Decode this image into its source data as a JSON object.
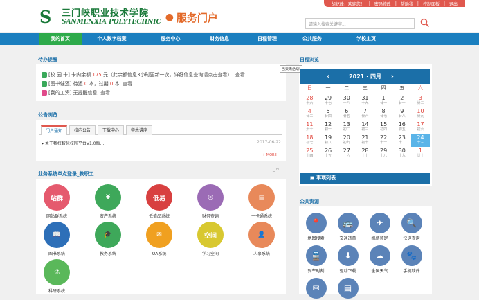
{
  "topbar": {
    "welcome": "胡屹峰，欢迎您！",
    "change_pwd": "密码修改",
    "help": "帮助我",
    "control": "控制面板",
    "logout": "退出"
  },
  "header": {
    "logo_cn": "三门峡职业技术学院",
    "logo_en": "SANMENXIA POLYTECHNIC",
    "portal": "服务门户",
    "search_placeholder": "请输入搜索关键字..."
  },
  "nav": [
    {
      "label": "我的首页",
      "active": true
    },
    {
      "label": "个人数字档案"
    },
    {
      "label": "服务中心"
    },
    {
      "label": "财务信息"
    },
    {
      "label": "日程管理"
    },
    {
      "label": "公共服务"
    },
    {
      "label": "学校主页"
    }
  ],
  "todo": {
    "title": "待办提醒",
    "rows": [
      {
        "prefix": "[校 园 卡] 卡内余额",
        "amount": "175",
        "suffix": "元（此余额信息3小时更新一次，详细信息查询请点击查看）",
        "link": "查看",
        "color": "#3aa85a"
      },
      {
        "prefix": "[图书催还] 待还",
        "amount": "0",
        "mid": "本，过期",
        "amount2": "0",
        "suffix": "本",
        "link": "查看",
        "color": "#3aa85a"
      },
      {
        "prefix": "[我的工资] 无提醒信息",
        "link": "查看",
        "color": "#e04a8a"
      }
    ]
  },
  "announce": {
    "title": "公告浏览",
    "tabs": [
      "门户通知",
      "校内公告",
      "下载中心",
      "学术讲座"
    ],
    "items": [
      {
        "text": "关于我校智慧校园平台V1.0版...",
        "date": "2017-06-22"
      }
    ],
    "more": "MORE"
  },
  "apps": {
    "title": "业务系统单点登录_教职工",
    "items": [
      {
        "label": "网站群系统",
        "color": "#e55a6e",
        "glyph": "站群"
      },
      {
        "label": "资产系统",
        "color": "#3ea85a",
        "glyph": "¥"
      },
      {
        "label": "低值品系统",
        "color": "#d84040",
        "glyph": "低易"
      },
      {
        "label": "财务查询",
        "color": "#9b6bb5",
        "glyph": "◎"
      },
      {
        "label": "一卡通系统",
        "color": "#e8895a",
        "glyph": "▤"
      },
      {
        "label": "图书系统",
        "color": "#2d6fb8",
        "glyph": "📖"
      },
      {
        "label": "教务系统",
        "color": "#3ea85a",
        "glyph": "🎓"
      },
      {
        "label": "OA系统",
        "color": "#f0a020",
        "glyph": "✉"
      },
      {
        "label": "学习空间",
        "color": "#d8c830",
        "glyph": "空间"
      },
      {
        "label": "人事系统",
        "color": "#e8895a",
        "glyph": "👤"
      },
      {
        "label": "科研系统",
        "color": "#5ab85a",
        "glyph": "⚗"
      }
    ]
  },
  "calendar": {
    "title": "日程浏览",
    "tooltip": "当天无活动!",
    "month_label": "2021 · 四月",
    "weekdays": [
      "日",
      "一",
      "二",
      "三",
      "四",
      "五",
      "六"
    ],
    "rows": [
      [
        [
          "28",
          "十六"
        ],
        [
          "29",
          "十七"
        ],
        [
          "30",
          "十八"
        ],
        [
          "31",
          "十九"
        ],
        [
          "1",
          "廿一"
        ],
        [
          "2",
          "廿一"
        ],
        [
          "3",
          "廿二"
        ]
      ],
      [
        [
          "4",
          "廿三"
        ],
        [
          "5",
          "廿四"
        ],
        [
          "6",
          "廿五"
        ],
        [
          "7",
          "廿六"
        ],
        [
          "8",
          "廿七"
        ],
        [
          "9",
          "廿八"
        ],
        [
          "10",
          "廿九"
        ]
      ],
      [
        [
          "11",
          "卅十"
        ],
        [
          "12",
          "初一"
        ],
        [
          "13",
          "初二"
        ],
        [
          "14",
          "初三"
        ],
        [
          "15",
          "初四"
        ],
        [
          "16",
          "初五"
        ],
        [
          "17",
          "初六"
        ]
      ],
      [
        [
          "18",
          "初七"
        ],
        [
          "19",
          "初八"
        ],
        [
          "20",
          "初九"
        ],
        [
          "21",
          "初十"
        ],
        [
          "22",
          "十一"
        ],
        [
          "23",
          "十二"
        ],
        [
          "24",
          "十三"
        ]
      ],
      [
        [
          "25",
          "十四"
        ],
        [
          "26",
          "十五"
        ],
        [
          "27",
          "十六"
        ],
        [
          "28",
          "十七"
        ],
        [
          "29",
          "十八"
        ],
        [
          "30",
          "十九"
        ],
        [
          "1",
          "廿十"
        ]
      ]
    ],
    "today": "24",
    "events_title": "事项列表"
  },
  "resources": {
    "title": "公共资源",
    "items": [
      "地图搜索",
      "交通违章",
      "机票预定",
      "快递查询",
      "列车时刻",
      "驱动下载",
      "全国天气",
      "手机软件",
      "",
      ""
    ]
  }
}
